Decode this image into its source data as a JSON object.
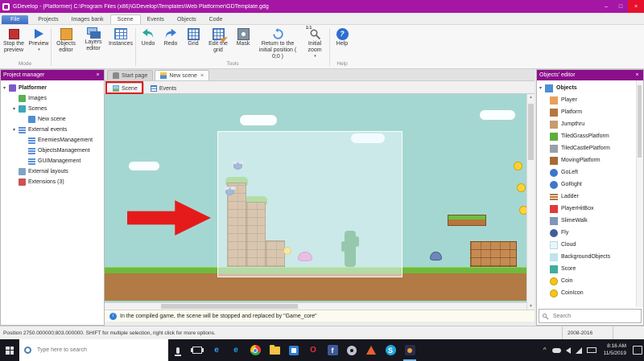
{
  "colors": {
    "titlebar": "#A516A5",
    "panel_header": "#8B0F8B",
    "annotation_red": "#E01B1B",
    "sky": "#A5D7D2",
    "taskbar": "#16161F",
    "close_button": "#E8112D"
  },
  "window": {
    "title": "GDevelop - [Platformer] C:\\Program Files (x86)\\GDevelop\\Templates\\Web Platformer\\GDTemplate.gdg",
    "controls": {
      "minimize": "–",
      "maximize": "□",
      "close": "×"
    }
  },
  "ui_glyphs": {
    "close": "×",
    "tab_close": "×",
    "dropdown": "▾",
    "expander": "▾",
    "info": "i",
    "question": "?",
    "up_arrow": "▲",
    "down_arrow": "▼",
    "left_arrow": "◄",
    "right_arrow": "►",
    "tray_chevron": "^"
  },
  "ribbon": {
    "tabs": [
      "File",
      "Projects",
      "Images bank",
      "Scene",
      "Events",
      "Objects",
      "Code"
    ],
    "active_tab": "Scene",
    "buttons": {
      "stop_preview": "Stop the preview",
      "preview": "Preview",
      "objects_editor": "Objects editor",
      "layers_editor": "Layers editor",
      "instances": "Instances",
      "undo": "Undo",
      "redo": "Redo",
      "grid": "Grid",
      "edit_grid": "Edit the grid",
      "mask": "Mask",
      "return_initial": "Return to the initial position ( 0;0 )",
      "initial_zoom": "Initial zoom",
      "help": "Help"
    },
    "zoom_icon": "1:1",
    "groups": {
      "mode": "Mode",
      "tools": "Tools",
      "help": "Help"
    }
  },
  "project_manager": {
    "title": "Project manager",
    "items": [
      {
        "label": "Platformer",
        "level": 0
      },
      {
        "label": "Images",
        "level": 1
      },
      {
        "label": "Scenes",
        "level": 1
      },
      {
        "label": "New scene",
        "level": 2
      },
      {
        "label": "External events",
        "level": 1
      },
      {
        "label": "EnemiesManagement",
        "level": 2
      },
      {
        "label": "ObjectsManagement",
        "level": 2
      },
      {
        "label": "GUIManagement",
        "level": 2
      },
      {
        "label": "External layouts",
        "level": 1
      },
      {
        "label": "Extensions (3)",
        "level": 1
      }
    ]
  },
  "document_tabs": {
    "start_page": "Start page",
    "new_scene": "New scene"
  },
  "editor_tabs": {
    "scene": "Scene",
    "events": "Events"
  },
  "scene_view": {
    "annotations": {
      "arrow": "red arrow pointing right at the brick platforms",
      "tab_highlight": "red box drawn around the Scene tab"
    },
    "visible_objects": [
      "Cloud",
      "Platform",
      "TiledGrassPlatform",
      "Coin",
      "SlimeWalk",
      "Fly",
      "Cactus",
      "Ground"
    ],
    "selection_area_visible": true
  },
  "info_bar": "In the compiled game, the scene will be stopped and replaced by \"Game_core\"",
  "status_bar": {
    "left": "Position 2750.000000;803.000000. SHIFT for multiple selection, right click for more options.",
    "right": "2008-2016"
  },
  "objects_editor": {
    "title": "Objects' editor",
    "root": "Objects",
    "objects": [
      "Player",
      "Platform",
      "Jumpthru",
      "TiledGrassPlatform",
      "TiledCastlePlatform",
      "MovingPlatform",
      "GoLeft",
      "GoRight",
      "Ladder",
      "PlayerHitBox",
      "SlimeWalk",
      "Fly",
      "Cloud",
      "BackgroundObjects",
      "Score",
      "Coin",
      "CoinIcon"
    ],
    "search_placeholder": "Search"
  },
  "taskbar": {
    "search_placeholder": "Type here to search",
    "icons": [
      {
        "name": "edge",
        "glyph": "e"
      },
      {
        "name": "internet-explorer",
        "glyph": "e"
      },
      {
        "name": "chrome",
        "glyph": ""
      },
      {
        "name": "file-explorer",
        "glyph": ""
      },
      {
        "name": "store",
        "glyph": ""
      },
      {
        "name": "opera",
        "glyph": "O"
      },
      {
        "name": "facebook",
        "glyph": "f"
      },
      {
        "name": "settings",
        "glyph": ""
      },
      {
        "name": "vlc",
        "glyph": ""
      },
      {
        "name": "skype",
        "glyph": "S"
      },
      {
        "name": "gdevelop",
        "glyph": ""
      }
    ],
    "tray_time": "8:16 AM",
    "tray_date": "11/5/2019"
  }
}
